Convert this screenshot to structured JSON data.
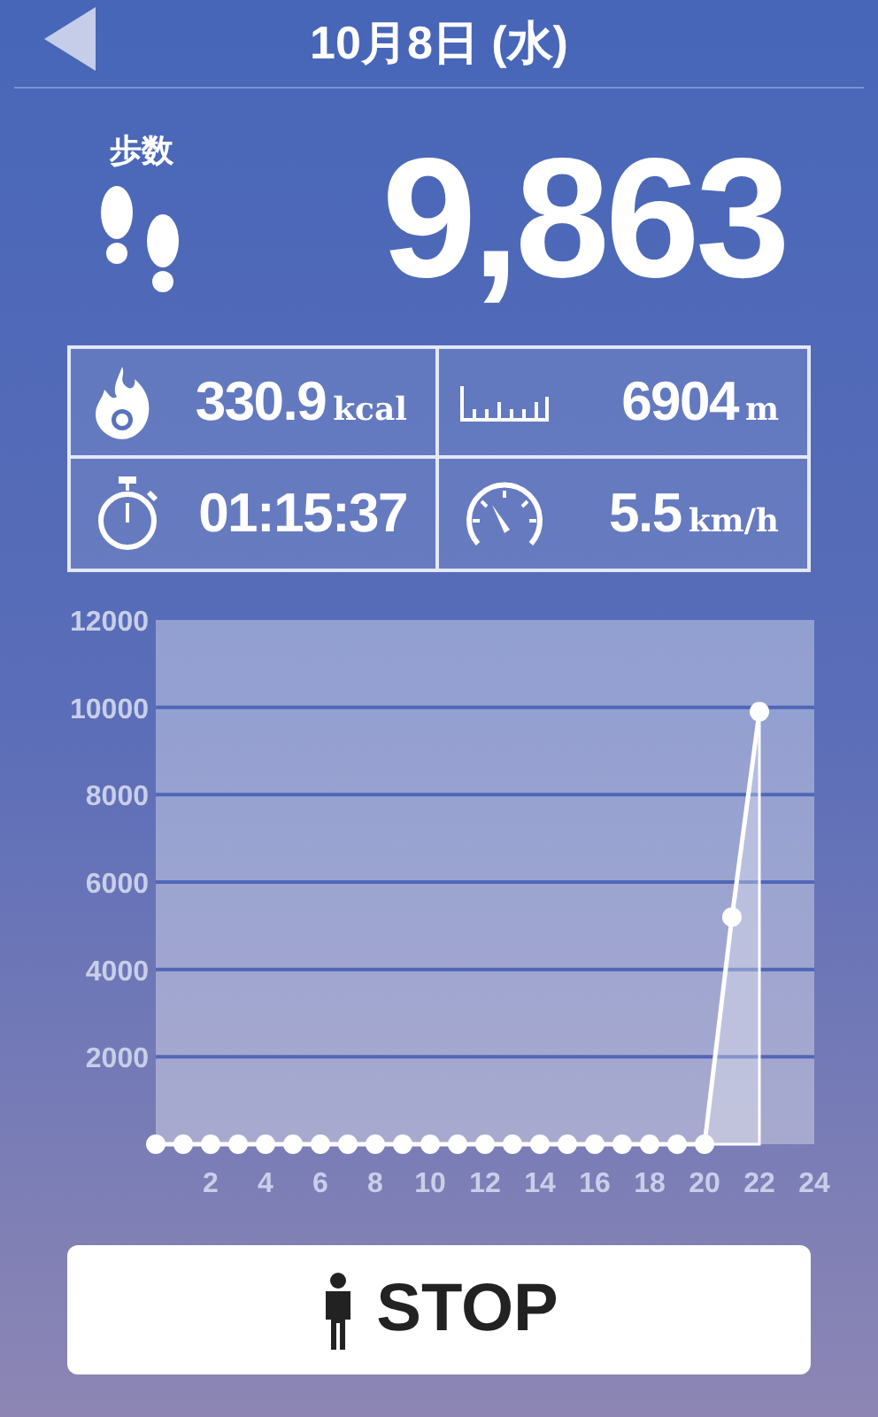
{
  "header": {
    "title": "10月8日 (水)"
  },
  "steps": {
    "label": "歩数",
    "value": "9,863"
  },
  "stats": [
    {
      "kind": "calories",
      "value": "330.9",
      "unit": "kcal"
    },
    {
      "kind": "distance",
      "value": "6904",
      "unit": "m"
    },
    {
      "kind": "time",
      "value": "01:15:37"
    },
    {
      "kind": "speed",
      "value": "5.5",
      "unit": "km/h"
    }
  ],
  "chart": {
    "chart_data": {
      "type": "area",
      "x": [
        0,
        1,
        2,
        3,
        4,
        5,
        6,
        7,
        8,
        9,
        10,
        11,
        12,
        13,
        14,
        15,
        16,
        17,
        18,
        19,
        20,
        21,
        22
      ],
      "grid": true,
      "series": [
        {
          "color": "#ffffff",
          "values": [
            0,
            0,
            0,
            0,
            0,
            0,
            0,
            0,
            0,
            0,
            0,
            0,
            0,
            0,
            0,
            0,
            0,
            0,
            0,
            0,
            0,
            5200,
            9900
          ]
        }
      ],
      "xlim": [
        0,
        24
      ],
      "ylim": [
        0,
        12000
      ],
      "xticks": [
        2,
        4,
        6,
        8,
        10,
        12,
        14,
        16,
        18,
        20,
        22,
        24
      ],
      "yticks": [
        2000,
        4000,
        6000,
        8000,
        10000,
        12000
      ]
    }
  },
  "stop_button": {
    "label": "STOP"
  }
}
